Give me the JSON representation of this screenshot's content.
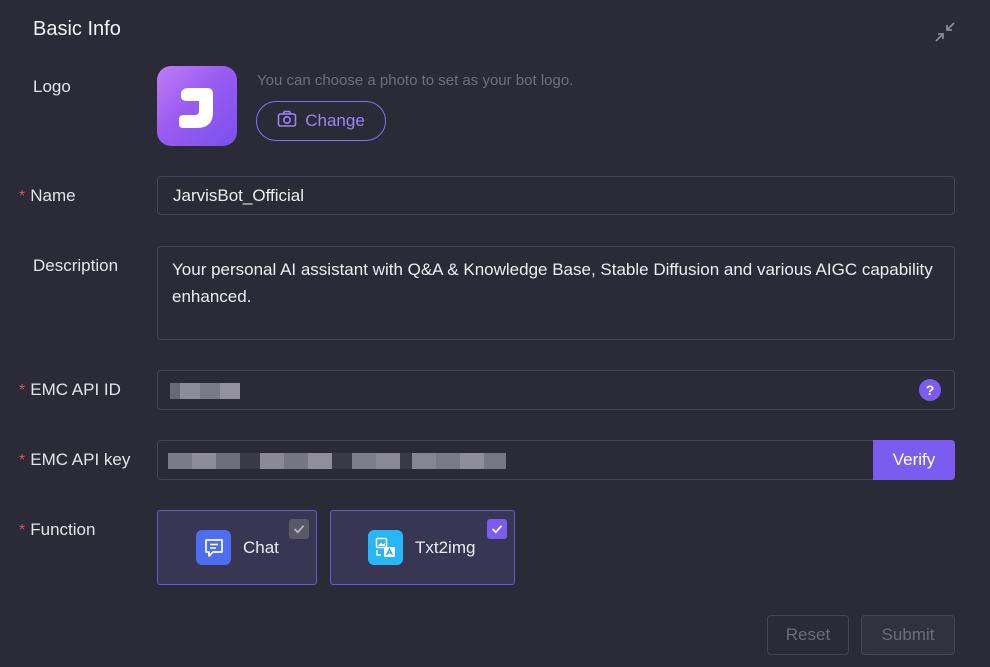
{
  "panel": {
    "title": "Basic Info"
  },
  "logo": {
    "label": "Logo",
    "hint": "You can choose a photo to set as your bot logo.",
    "change_label": "Change",
    "letter": "J"
  },
  "name": {
    "label": "Name",
    "value": "JarvisBot_Official"
  },
  "description": {
    "label": "Description",
    "value": "Your personal AI assistant with Q&A & Knowledge Base, Stable Diffusion and various AIGC capability enhanced."
  },
  "emc_api_id": {
    "label": "EMC API ID",
    "help": "?"
  },
  "emc_api_key": {
    "label": "EMC API key",
    "verify_label": "Verify"
  },
  "function": {
    "label": "Function",
    "options": [
      {
        "label": "Chat",
        "checked": true,
        "icon": "chat-icon",
        "color": "#4e6ef2"
      },
      {
        "label": "Txt2img",
        "checked": true,
        "icon": "image-text-icon",
        "color": "#29b6f6"
      }
    ]
  },
  "actions": {
    "reset_label": "Reset",
    "submit_label": "Submit"
  },
  "colors": {
    "accent": "#7a5cf1",
    "required": "#e0504f",
    "background": "#2b2a37"
  }
}
